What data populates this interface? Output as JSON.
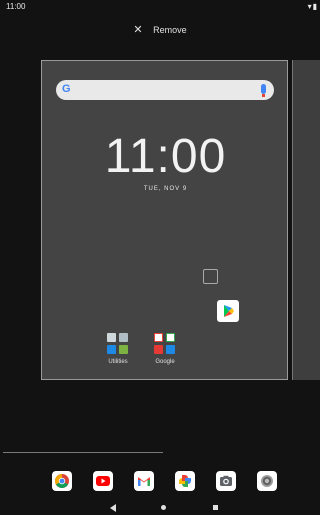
{
  "status_bar": {
    "time": "11:00",
    "icons": [
      "wifi-icon",
      "battery-icon"
    ]
  },
  "remove_bar": {
    "icon": "close-icon",
    "label": "Remove"
  },
  "home_preview": {
    "search": {
      "logo": "G",
      "mic": "mic-icon"
    },
    "clock": "11:00",
    "date": "TUE, NOV 9",
    "folders": [
      {
        "label": "Utilities",
        "icon": "folder-utilities-icon"
      },
      {
        "label": "Google",
        "icon": "folder-google-icon"
      }
    ],
    "shortcut": "play-store-icon"
  },
  "dock": {
    "apps": [
      "chrome-icon",
      "youtube-icon",
      "gmail-icon",
      "photos-icon",
      "camera-icon",
      "settings-icon"
    ]
  },
  "nav_bar": {
    "buttons": [
      "back-button",
      "home-button",
      "recents-button"
    ]
  },
  "colors": {
    "background": "#121212",
    "card": "#444444",
    "accent_blue": "#4285f4"
  }
}
